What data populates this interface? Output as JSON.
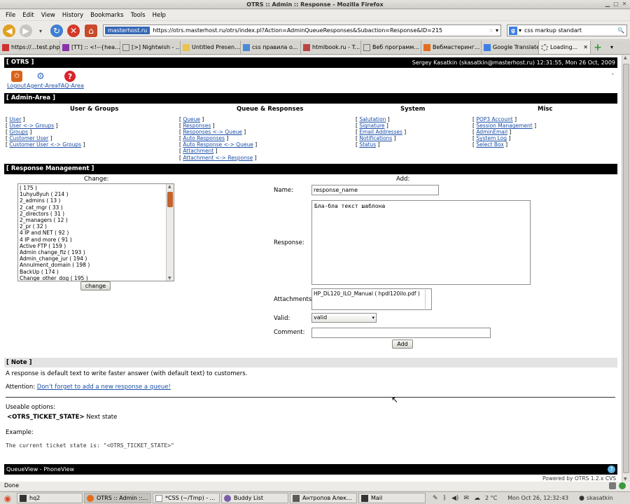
{
  "window": {
    "title": "OTRS :: Admin :: Response - Mozilla Firefox"
  },
  "menu": [
    "File",
    "Edit",
    "View",
    "History",
    "Bookmarks",
    "Tools",
    "Help"
  ],
  "nav": {
    "site": "masterhost.ru",
    "url": "https://otrs.masterhost.ru/otrs/index.pl?Action=AdminQueueResponses&Subaction=Response&ID=215",
    "search": "css markup standart"
  },
  "tabs": [
    "https://...test.php",
    "[TT] :: <!--{hea...",
    "[>] Nightwish - ...",
    "Untitled Presen...",
    "css правила о...",
    "htmlbook.ru - T...",
    "Веб программ...",
    "Вебмастеринг...",
    "Google Translate",
    "Loading..."
  ],
  "otrs": {
    "brand": "[ OTRS ]",
    "user": "Sergey Kasatkin (skasatkin@masterhost.ru) 12:31:55, Mon 26 Oct, 2009",
    "dash": "-",
    "toolbar": [
      "Logout",
      "Agent-Area",
      "FAQ-Area"
    ],
    "admin_area": "[ Admin-Area ]",
    "cols": [
      {
        "title": "User & Groups",
        "links": [
          "User",
          "User <-> Groups",
          "Groups",
          "Customer User",
          "Customer User <-> Groups"
        ]
      },
      {
        "title": "Queue & Responses",
        "links": [
          "Queue",
          "Responses",
          "Responses <-> Queue",
          "Auto Responses",
          "Auto Response <-> Queue",
          "Attachment",
          "Attachment <-> Response"
        ]
      },
      {
        "title": "System",
        "links": [
          "Salutation",
          "Signature",
          "Email Addresses",
          "Notifications",
          "Status"
        ]
      },
      {
        "title": "Misc",
        "links": [
          "POP3 Account",
          "Session Management",
          "AdminEmail",
          "System Log",
          "Select Box"
        ]
      }
    ],
    "response_mgmt": "[ Response Management ]",
    "change_label": "Change:",
    "responses": [
      "( 175 )",
      "1uhyu8yuh ( 214 )",
      "2_admins ( 13 )",
      "2_cat_mgr ( 33 )",
      "2_directors ( 31 )",
      "2_managers ( 12 )",
      "2_pr ( 32 )",
      "4 IP and NET ( 92 )",
      "4 IP and more ( 91 )",
      "Active FTP ( 159 )",
      "Admin change_fiz ( 193 )",
      "Admin_change_jur ( 194 )",
      "Annulment_domain ( 198 )",
      "BackUp ( 174 )",
      "Change_other_dog ( 195 )"
    ],
    "change_button": "change",
    "add_label": "Add:",
    "form": {
      "name_label": "Name:",
      "name_value": "response_name",
      "response_label": "Response:",
      "response_value": "Бла-бла текст шаблона",
      "attachments_label": "Attachments:",
      "attachment": "HP_DL120_ILO_Manual ( hpdl120ilo.pdf )",
      "valid_label": "Valid:",
      "valid_value": "valid",
      "comment_label": "Comment:",
      "comment_value": "",
      "add_button": "Add"
    },
    "note_title": "[ Note ]",
    "note_text": "A response is default text to write faster answer (with default text) to customers.",
    "attention_label": "Attention:",
    "attention_link": "Don't forget to add a new response a queue!",
    "useable": "Useable options:",
    "option_tag": "<OTRS_TICKET_STATE>",
    "option_desc": "Next state",
    "example_label": "Example:",
    "example_code": "The current ticket state is: \"<OTRS_TICKET_STATE>\"",
    "footer_views": "QueueView - PhoneView",
    "powered": "Powered by OTRS 1.2.x CVS"
  },
  "status": "Done",
  "taskbar": {
    "items": [
      "hq2",
      "OTRS :: Admin ::...",
      "*CSS (~/Tmp) - ...",
      "Buddy List",
      "Антропов Алек...",
      "Mail"
    ],
    "temp": "2 °C",
    "clock": "Mon Oct 26, 12:32:43",
    "user": "skasatkin"
  },
  "colors": {
    "black_bar": "#000000",
    "link": "#1b4fa8"
  }
}
